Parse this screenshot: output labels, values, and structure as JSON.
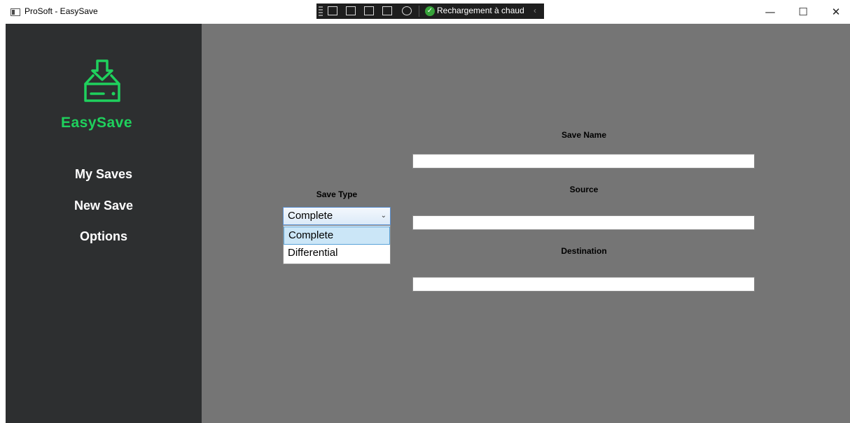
{
  "window": {
    "title": "ProSoft - EasySave",
    "controls": {
      "minimize": "—",
      "maximize": "☐",
      "close": "✕"
    }
  },
  "devbar": {
    "hot_reload_label": "Rechargement à chaud",
    "collapse_glyph": "‹"
  },
  "sidebar": {
    "brand": "EasySave",
    "brand_color": "#1fd15d",
    "nav": [
      {
        "label": "My Saves"
      },
      {
        "label": "New Save"
      },
      {
        "label": "Options"
      }
    ]
  },
  "form": {
    "save_type_label": "Save Type",
    "save_type_selected": "Complete",
    "save_type_options": [
      "Complete",
      "Differential"
    ],
    "save_name_label": "Save Name",
    "save_name_value": "",
    "source_label": "Source",
    "source_value": "",
    "destination_label": "Destination",
    "destination_value": ""
  }
}
